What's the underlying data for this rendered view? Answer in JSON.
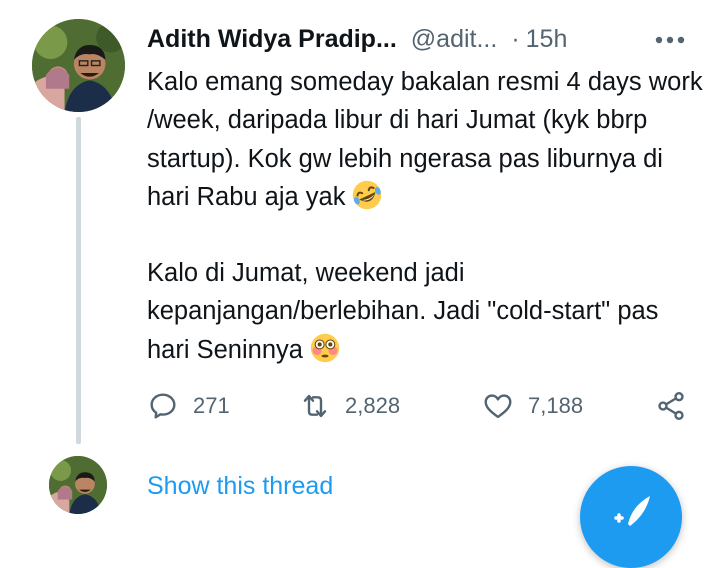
{
  "tweet": {
    "author_name": "Adith Widya Pradip...",
    "author_handle": "@adit...",
    "separator": "·",
    "time": "15h",
    "text_paragraph_1": "Kalo emang someday bakalan resmi 4 days work /week, daripada libur di hari Jumat (kyk bbrp startup). Kok gw lebih ngerasa pas liburnya di hari Rabu aja yak",
    "emoji_1": "rolling-on-floor-laughing",
    "text_paragraph_2": "Kalo di Jumat, weekend jadi kepanjangan/berlebihan. Jadi \"cold-start\" pas hari Seninnya",
    "emoji_2": "flushed-face",
    "replies": "271",
    "retweets": "2,828",
    "likes": "7,188"
  },
  "thread": {
    "show_thread_label": "Show this thread"
  },
  "icons": {
    "more": "more-horizontal-icon",
    "reply": "reply-icon",
    "retweet": "retweet-icon",
    "like": "heart-icon",
    "share": "share-icon",
    "compose": "compose-tweet-icon"
  },
  "colors": {
    "link_blue": "#1d9bf0",
    "secondary_text": "#536471",
    "thread_line": "#cfd9de"
  }
}
